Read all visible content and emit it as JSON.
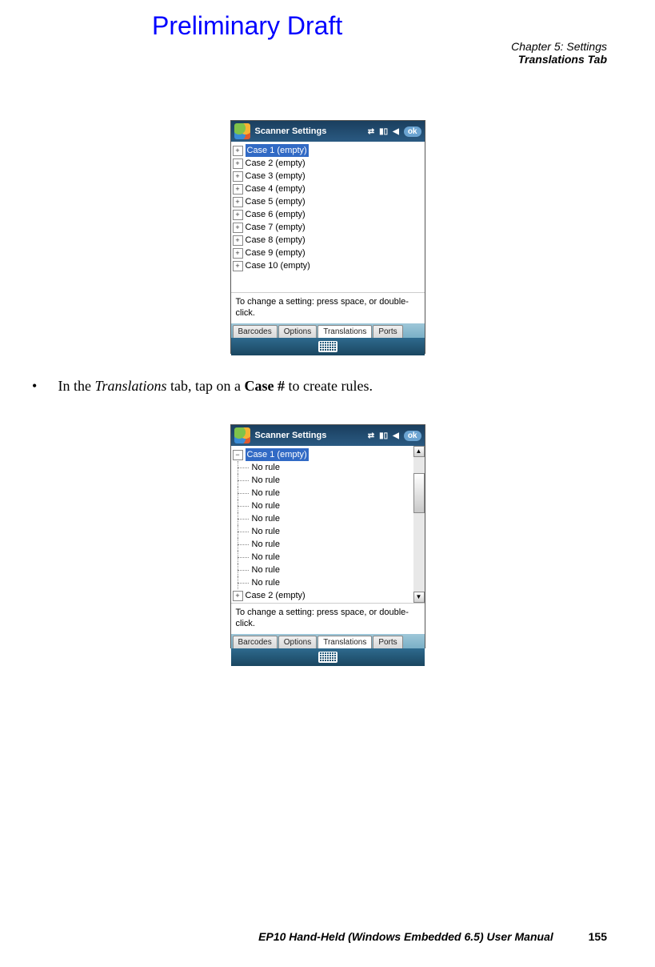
{
  "header": {
    "draft": "Preliminary Draft",
    "chapter_line": "Chapter 5: Settings",
    "section_line": "Translations Tab"
  },
  "screenshot1": {
    "title": "Scanner Settings",
    "ok": "ok",
    "cases": [
      "Case 1 (empty)",
      "Case 2 (empty)",
      "Case 3 (empty)",
      "Case 4 (empty)",
      "Case 5 (empty)",
      "Case 6 (empty)",
      "Case 7 (empty)",
      "Case 8 (empty)",
      "Case 9 (empty)",
      "Case 10 (empty)"
    ],
    "hint": "To change a setting: press space, or double-click.",
    "tabs": [
      "Barcodes",
      "Options",
      "Translations",
      "Ports"
    ]
  },
  "body": {
    "bullet": "•",
    "pre": "In the ",
    "italic": "Translations",
    "mid": " tab, tap on a ",
    "bold": "Case #",
    "post": " to create rules."
  },
  "screenshot2": {
    "title": "Scanner Settings",
    "ok": "ok",
    "case1": "Case 1 (empty)",
    "rules": [
      "No rule",
      "No rule",
      "No rule",
      "No rule",
      "No rule",
      "No rule",
      "No rule",
      "No rule",
      "No rule",
      "No rule"
    ],
    "case2": "Case 2 (empty)",
    "hint": "To change a setting: press space, or double-click.",
    "tabs": [
      "Barcodes",
      "Options",
      "Translations",
      "Ports"
    ]
  },
  "footer": {
    "text": "EP10 Hand-Held (Windows Embedded 6.5) User Manual",
    "page": "155"
  }
}
